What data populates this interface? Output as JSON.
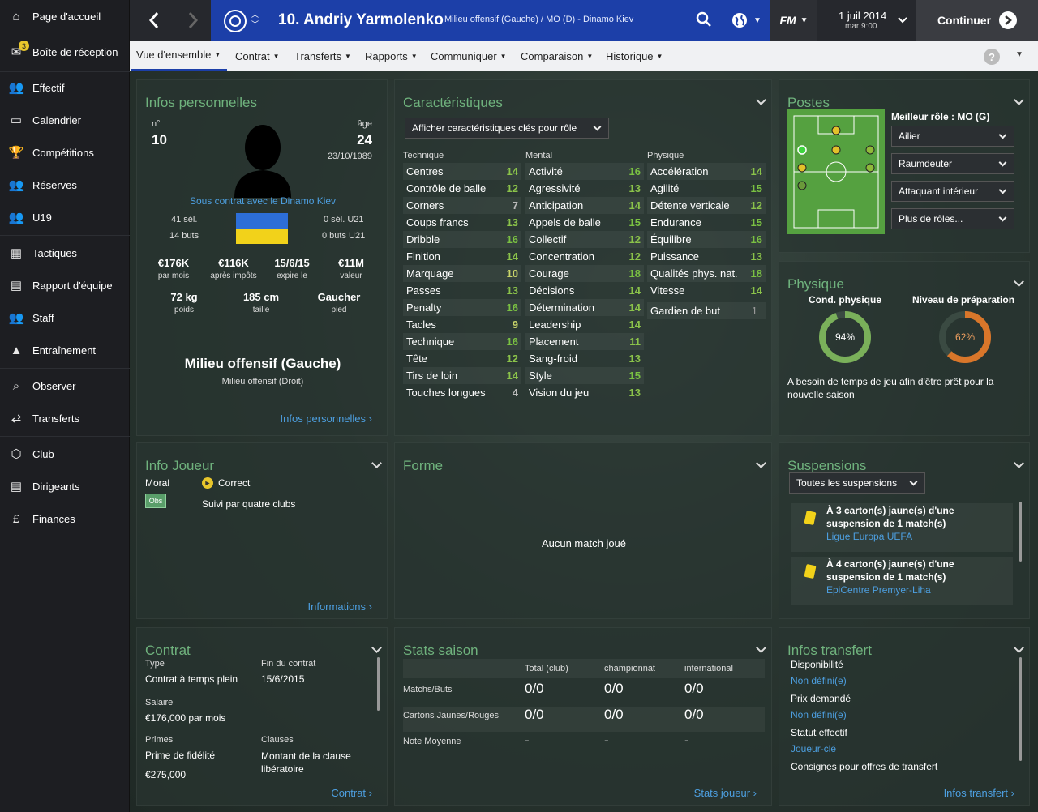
{
  "sidebar": {
    "items": [
      {
        "label": "Page d'accueil",
        "icon": "home-icon"
      },
      {
        "label": "Boîte de réception",
        "icon": "inbox-icon",
        "badge": "3"
      },
      {
        "label": "Effectif",
        "icon": "squad-icon"
      },
      {
        "label": "Calendrier",
        "icon": "calendar-icon"
      },
      {
        "label": "Compétitions",
        "icon": "trophy-icon"
      },
      {
        "label": "Réserves",
        "icon": "reserves-icon"
      },
      {
        "label": "U19",
        "icon": "u19-icon"
      },
      {
        "label": "Tactiques",
        "icon": "tactics-icon"
      },
      {
        "label": "Rapport d'équipe",
        "icon": "report-icon"
      },
      {
        "label": "Staff",
        "icon": "staff-icon"
      },
      {
        "label": "Entraînement",
        "icon": "training-icon"
      },
      {
        "label": "Observer",
        "icon": "scout-icon"
      },
      {
        "label": "Transferts",
        "icon": "transfers-icon"
      },
      {
        "label": "Club",
        "icon": "club-icon"
      },
      {
        "label": "Dirigeants",
        "icon": "board-icon"
      },
      {
        "label": "Finances",
        "icon": "finances-icon"
      }
    ]
  },
  "topbar": {
    "player_name": "10. Andriy Yarmolenko",
    "subtitle": "Milieu offensif (Gauche) / MO (D) - Dinamo Kiev",
    "fm_label": "FM",
    "date": "1 juil 2014",
    "time": "mar 9:00",
    "continue": "Continuer"
  },
  "tabs": [
    "Vue d'ensemble",
    "Contrat",
    "Transferts",
    "Rapports",
    "Communiquer",
    "Comparaison",
    "Historique"
  ],
  "personal": {
    "title": "Infos personnelles",
    "num_label": "n°",
    "num": "10",
    "age_label": "âge",
    "age": "24",
    "dob": "23/10/1989",
    "contract_status": "Sous contrat avec le Dinamo Kiev",
    "caps": "41 sél.",
    "goals": "14 buts",
    "u21_caps": "0 sél. U21",
    "u21_goals": "0 buts U21",
    "fin": [
      {
        "v": "€176K",
        "l": "par mois"
      },
      {
        "v": "€116K",
        "l": "après impôts"
      },
      {
        "v": "15/6/15",
        "l": "expire le"
      },
      {
        "v": "€11M",
        "l": "valeur"
      }
    ],
    "phys": [
      {
        "v": "72 kg",
        "l": "poids"
      },
      {
        "v": "185 cm",
        "l": "taille"
      },
      {
        "v": "Gaucher",
        "l": "pied"
      }
    ],
    "position": "Milieu offensif (Gauche)",
    "position2": "Milieu offensif (Droit)",
    "link": "Infos personnelles"
  },
  "attributes": {
    "title": "Caractéristiques",
    "dropdown": "Afficher caractéristiques clés pour rôle",
    "headers": [
      "Technique",
      "Mental",
      "Physique"
    ],
    "technique": [
      [
        "Centres",
        "14"
      ],
      [
        "Contrôle de balle",
        "12"
      ],
      [
        "Corners",
        "7"
      ],
      [
        "Coups francs",
        "13"
      ],
      [
        "Dribble",
        "16"
      ],
      [
        "Finition",
        "14"
      ],
      [
        "Marquage",
        "10"
      ],
      [
        "Passes",
        "13"
      ],
      [
        "Penalty",
        "16"
      ],
      [
        "Tacles",
        "9"
      ],
      [
        "Technique",
        "16"
      ],
      [
        "Tête",
        "12"
      ],
      [
        "Tirs de loin",
        "14"
      ],
      [
        "Touches longues",
        "4"
      ]
    ],
    "mental": [
      [
        "Activité",
        "16"
      ],
      [
        "Agressivité",
        "13"
      ],
      [
        "Anticipation",
        "14"
      ],
      [
        "Appels de balle",
        "15"
      ],
      [
        "Collectif",
        "12"
      ],
      [
        "Concentration",
        "12"
      ],
      [
        "Courage",
        "18"
      ],
      [
        "Décisions",
        "14"
      ],
      [
        "Détermination",
        "14"
      ],
      [
        "Leadership",
        "14"
      ],
      [
        "Placement",
        "11"
      ],
      [
        "Sang-froid",
        "13"
      ],
      [
        "Style",
        "15"
      ],
      [
        "Vision du jeu",
        "13"
      ]
    ],
    "physique": [
      [
        "Accélération",
        "14"
      ],
      [
        "Agilité",
        "15"
      ],
      [
        "Détente verticale",
        "12"
      ],
      [
        "Endurance",
        "15"
      ],
      [
        "Équilibre",
        "16"
      ],
      [
        "Puissance",
        "13"
      ],
      [
        "Qualités phys. nat.",
        "18"
      ],
      [
        "Vitesse",
        "14"
      ]
    ],
    "gk": [
      "Gardien de but",
      "1"
    ]
  },
  "positions": {
    "title": "Postes",
    "best_role": "Meilleur rôle : MO (G)",
    "roles": [
      "Ailier",
      "Raumdeuter",
      "Attaquant intérieur",
      "Plus de rôles..."
    ]
  },
  "physical": {
    "title": "Physique",
    "cond_label": "Cond. physique",
    "cond": 94,
    "cond_text": "94%",
    "prep_label": "Niveau de préparation",
    "prep": 62,
    "prep_text": "62%",
    "note": "A besoin de temps de jeu afin d'être prêt pour la nouvelle saison"
  },
  "player_info": {
    "title": "Info Joueur",
    "morale_label": "Moral",
    "morale": "Correct",
    "obs": "Obs",
    "followed": "Suivi par quatre clubs",
    "link": "Informations"
  },
  "form": {
    "title": "Forme",
    "empty": "Aucun match joué"
  },
  "suspensions": {
    "title": "Suspensions",
    "dropdown": "Toutes les suspensions",
    "items": [
      {
        "line1": "À 3 carton(s) jaune(s) d'une",
        "line2": "suspension de 1 match(s)",
        "comp": "Ligue Europa UEFA"
      },
      {
        "line1": "À 4 carton(s) jaune(s) d'une",
        "line2": "suspension de 1 match(s)",
        "comp": "EpiCentre Premyer-Liha"
      }
    ]
  },
  "contract": {
    "title": "Contrat",
    "type_label": "Type",
    "type": "Contrat à temps plein",
    "end_label": "Fin du contrat",
    "end": "15/6/2015",
    "salary_label": "Salaire",
    "salary": "€176,000 par mois",
    "bonus_label": "Primes",
    "bonus": "Prime de fidélité",
    "bonus_val": "€275,000",
    "clauses_label": "Clauses",
    "clause": "Montant de la clause libératoire",
    "link": "Contrat"
  },
  "season": {
    "title": "Stats saison",
    "cols": [
      "Total (club)",
      "championnat",
      "international"
    ],
    "rows": [
      [
        "Matchs/Buts",
        "0/0",
        "0/0",
        "0/0"
      ],
      [
        "Cartons Jaunes/Rouges",
        "0/0",
        "0/0",
        "0/0"
      ],
      [
        "Note Moyenne",
        "-",
        "-",
        "-"
      ]
    ],
    "link": "Stats joueur"
  },
  "transfer": {
    "title": "Infos transfert",
    "items": [
      [
        "Disponibilité",
        "Non défini(e)"
      ],
      [
        "Prix demandé",
        "Non défini(e)"
      ],
      [
        "Statut effectif",
        "Joueur-clé"
      ]
    ],
    "extra": "Consignes pour offres de transfert",
    "link": "Infos transfert"
  },
  "colors": {
    "accent": "#1c3fa8",
    "attr_green": "#7ac142",
    "cond": "#7ab05a",
    "prep": "#d9762a",
    "link": "#4d9fe0",
    "title_green": "#6fb27d"
  }
}
